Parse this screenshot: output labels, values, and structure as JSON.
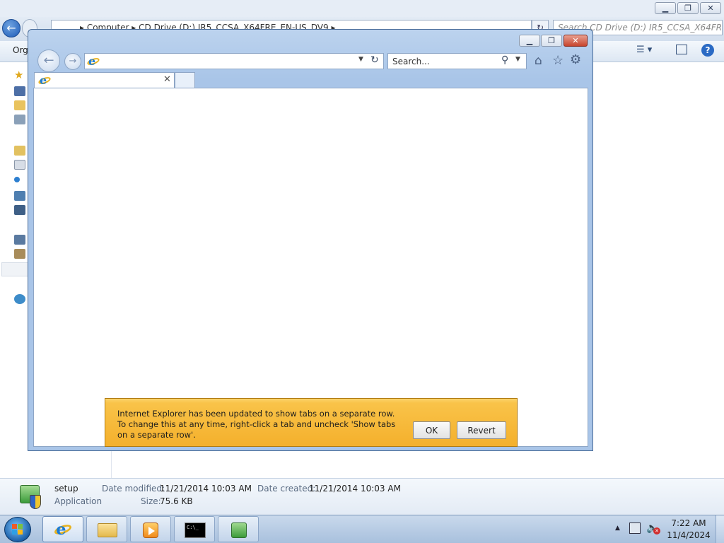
{
  "explorer": {
    "breadcrumb": "▸  Computer  ▸  CD Drive (D:) IR5_CCSA_X64FRE_EN-US_DV9  ▸",
    "search_placeholder": "Search CD Drive (D:) IR5_CCSA_X64FR...",
    "organize_label": "Org",
    "details": {
      "file_name": "setup",
      "file_type": "Application",
      "date_modified_label": "Date modified:",
      "date_modified": "11/21/2014 10:03 AM",
      "date_created_label": "Date created:",
      "date_created": "11/21/2014 10:03 AM",
      "size_label": "Size:",
      "size": "75.6 KB"
    }
  },
  "ie": {
    "address_value": "",
    "search_placeholder": "Search...",
    "tab_title": "",
    "notification": {
      "line1": "Internet Explorer has been updated to show tabs on a separate row.",
      "line2": "To change this at any time, right-click a tab and uncheck 'Show tabs on a separate row'.",
      "ok_label": "OK",
      "revert_label": "Revert"
    }
  },
  "taskbar": {
    "time": "7:22 AM",
    "date": "11/4/2024"
  },
  "icons": {
    "ie": "internet-explorer-icon",
    "folder": "file-explorer-icon",
    "media": "media-player-icon",
    "cmd": "command-prompt-icon",
    "setup": "setup-app-icon"
  },
  "colors": {
    "notification_bar": "#f9c349",
    "ie_frame": "#a9c5e8",
    "close_button": "#c7442c"
  }
}
